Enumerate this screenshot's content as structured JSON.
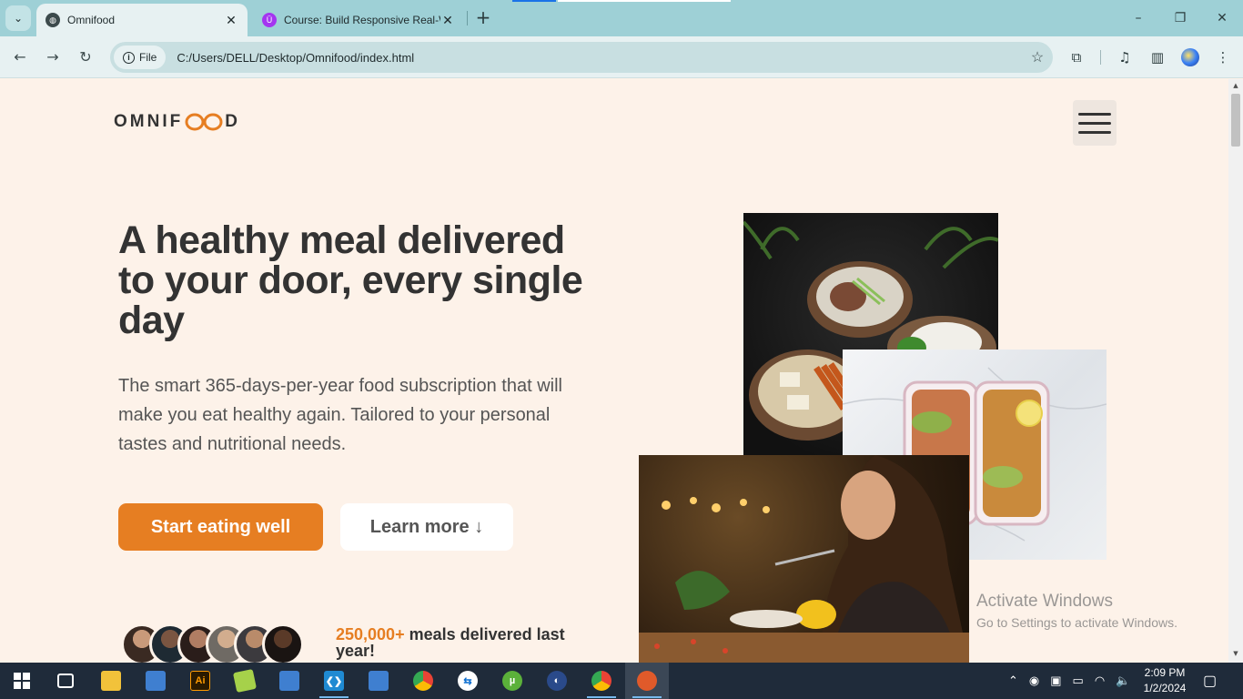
{
  "browser": {
    "tabs": [
      {
        "title": "Omnifood",
        "active": true,
        "favicon": "globe-icon"
      },
      {
        "title": "Course: Build Responsive Real-W",
        "active": false,
        "favicon": "udemy-icon"
      }
    ],
    "new_tab_symbol": "+",
    "site_chip": "File",
    "url": "C:/Users/DELL/Desktop/Omnifood/index.html",
    "accent": "#9ed0d6"
  },
  "page": {
    "logo": {
      "pre": "OMNIF",
      "post": "D"
    },
    "hero": {
      "title": "A healthy meal delivered to your door, every single day",
      "description": "The smart 365-days-per-year food subscription that will make you eat healthy again. Tailored to your personal tastes and nutritional needs.",
      "primary_button": "Start eating well",
      "secondary_button": "Learn more ↓"
    },
    "delivered": {
      "number": "250,000+",
      "text": " meals delivered last year!"
    },
    "brand_color": "#e67e22",
    "background_color": "#fdf2e9"
  },
  "watermark": {
    "line1": "Activate Windows",
    "line2": "Go to Settings to activate Windows."
  },
  "taskbar": {
    "apps": [
      "start-icon",
      "task-view-icon",
      "file-explorer-icon",
      "app-window-icon",
      "illustrator-icon",
      "image-editor-icon",
      "app-window-icon",
      "vscode-icon",
      "app-window-icon",
      "chrome-icon",
      "teamviewer-icon",
      "utorrent-icon",
      "media-icon",
      "chrome-profile-icon",
      "app-icon"
    ],
    "illustrator_label": "Ai",
    "time": "2:09 PM",
    "date": "1/2/2024"
  }
}
